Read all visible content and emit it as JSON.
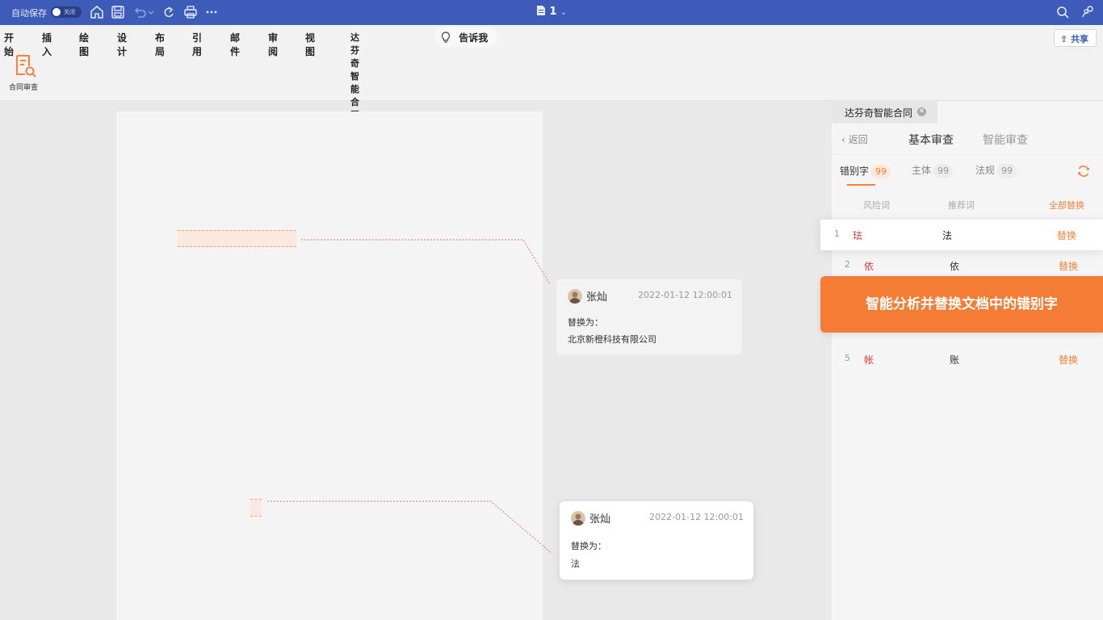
{
  "titlebar": {
    "autosave_label": "自动保存",
    "toggle_state": "关闭",
    "doc_name": "1"
  },
  "ribbon": {
    "tabs": [
      "开始",
      "插入",
      "绘图",
      "设计",
      "布局",
      "引用",
      "邮件",
      "审阅",
      "视图",
      "达芬奇智能合同"
    ],
    "active_tab": "达芬奇智能合同",
    "tell_me": "告诉我",
    "share": "共享",
    "contract_review": "合同审查"
  },
  "comments": [
    {
      "author": "张灿",
      "time": "2022-01-12 12:00:01",
      "label": "替换为：",
      "text": "北京新橙科技有限公司"
    },
    {
      "author": "张灿",
      "time": "2022-01-12 12:00:01",
      "label": "替换为：",
      "text": "法"
    }
  ],
  "panel": {
    "tab_title": "达芬奇智能合同",
    "back": "返回",
    "title_basic": "基本审查",
    "title_smart": "智能审查",
    "filters": [
      {
        "label": "错别字",
        "count": "99"
      },
      {
        "label": "主体",
        "count": "99"
      },
      {
        "label": "法规",
        "count": "99"
      }
    ],
    "table_headers": {
      "risk": "风险词",
      "recommend": "推荐词",
      "replace_all": "全部替换"
    },
    "rows": [
      {
        "num": "1",
        "risk": "珐",
        "recommend": "法",
        "action": "替换"
      },
      {
        "num": "2",
        "risk": "依",
        "recommend": "依",
        "action": "替换"
      },
      {
        "num": "5",
        "risk": "帐",
        "recommend": "账",
        "action": "替换"
      }
    ],
    "banner": "智能分析并替换文档中的错别字"
  },
  "colors": {
    "titlebar": "#3d5bb8",
    "accent": "#f5823b",
    "risk": "#e23c3c"
  }
}
